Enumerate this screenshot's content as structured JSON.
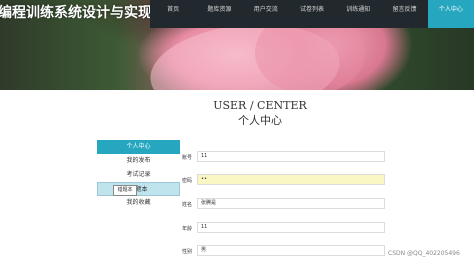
{
  "site": {
    "title": "编程训练系统设计与实现"
  },
  "nav": {
    "items": [
      {
        "label": "首页"
      },
      {
        "label": "题库资源"
      },
      {
        "label": "用户交流"
      },
      {
        "label": "试卷列表"
      },
      {
        "label": "训练通知"
      },
      {
        "label": "留言反馈"
      },
      {
        "label": "个人中心"
      }
    ],
    "active_index": 6
  },
  "heading": {
    "en": "USER / CENTER",
    "cn": "个人中心"
  },
  "side_menu": {
    "header": "个人中心",
    "items": [
      {
        "label": "我的发布"
      },
      {
        "label": "考试记录"
      },
      {
        "label": "错题本"
      },
      {
        "label": "我的收藏"
      }
    ],
    "tooltip": "错题本"
  },
  "form": {
    "fields": [
      {
        "label": "账号",
        "value": "11"
      },
      {
        "label": "密码",
        "value": "••"
      },
      {
        "label": "姓名",
        "value": "张腾是"
      },
      {
        "label": "年龄",
        "value": "11"
      },
      {
        "label": "性别",
        "value": "男"
      }
    ]
  },
  "watermark": "CSDN @QQ_402205496",
  "colors": {
    "accent": "#26a7bf",
    "nav_bg": "#22292e",
    "password_bg": "#fbf7c4"
  }
}
